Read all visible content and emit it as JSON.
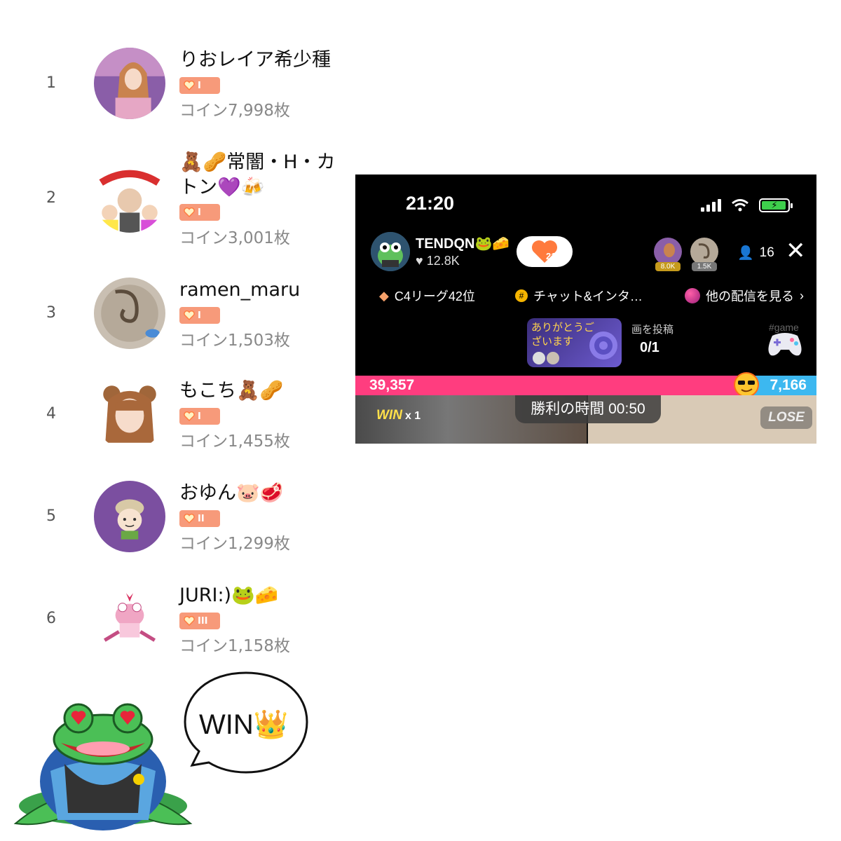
{
  "ranking": [
    {
      "rank": "1",
      "name": "りおレイア希少種",
      "level": "I",
      "coins": "コイン7,998枚"
    },
    {
      "rank": "2",
      "name": "🧸🥜常闇・H・カトン💜🍻",
      "level": "I",
      "coins": "コイン3,001枚"
    },
    {
      "rank": "3",
      "name": "ramen_maru",
      "level": "I",
      "coins": "コイン1,503枚"
    },
    {
      "rank": "4",
      "name": "もこち🧸🥜",
      "level": "I",
      "coins": "コイン1,455枚"
    },
    {
      "rank": "5",
      "name": "おゆん🐷🥩",
      "level": "II",
      "coins": "コイン1,299枚"
    },
    {
      "rank": "6",
      "name": "JURI:)🐸🧀",
      "level": "III",
      "coins": "コイン1,158枚"
    }
  ],
  "live": {
    "time": "21:20",
    "host_name": "TENDQN🐸🧀",
    "host_likes": "12.8K",
    "heart_level": "21",
    "viewers": [
      {
        "tag": "8.0K"
      },
      {
        "tag": "1.5K"
      }
    ],
    "viewer_count": "16",
    "league": "C4リーグ42位",
    "hashtag": "チャット&インタ…",
    "other_streams": "他の配信を見る",
    "thanks_text": "ありがとうございます",
    "post_label": "画を投稿",
    "post_count": "0/1",
    "game_tag": "#game",
    "score_left": "39,357",
    "score_right": "7,166",
    "win_label": "WIN",
    "win_count": "x 1",
    "timer": "勝利の時間 00:50",
    "lose_label": "LOSE",
    "colors": {
      "bar_pink": "#ff3d7f",
      "bar_blue": "#3cb8f0"
    }
  },
  "bubble_text": "WIN👑"
}
